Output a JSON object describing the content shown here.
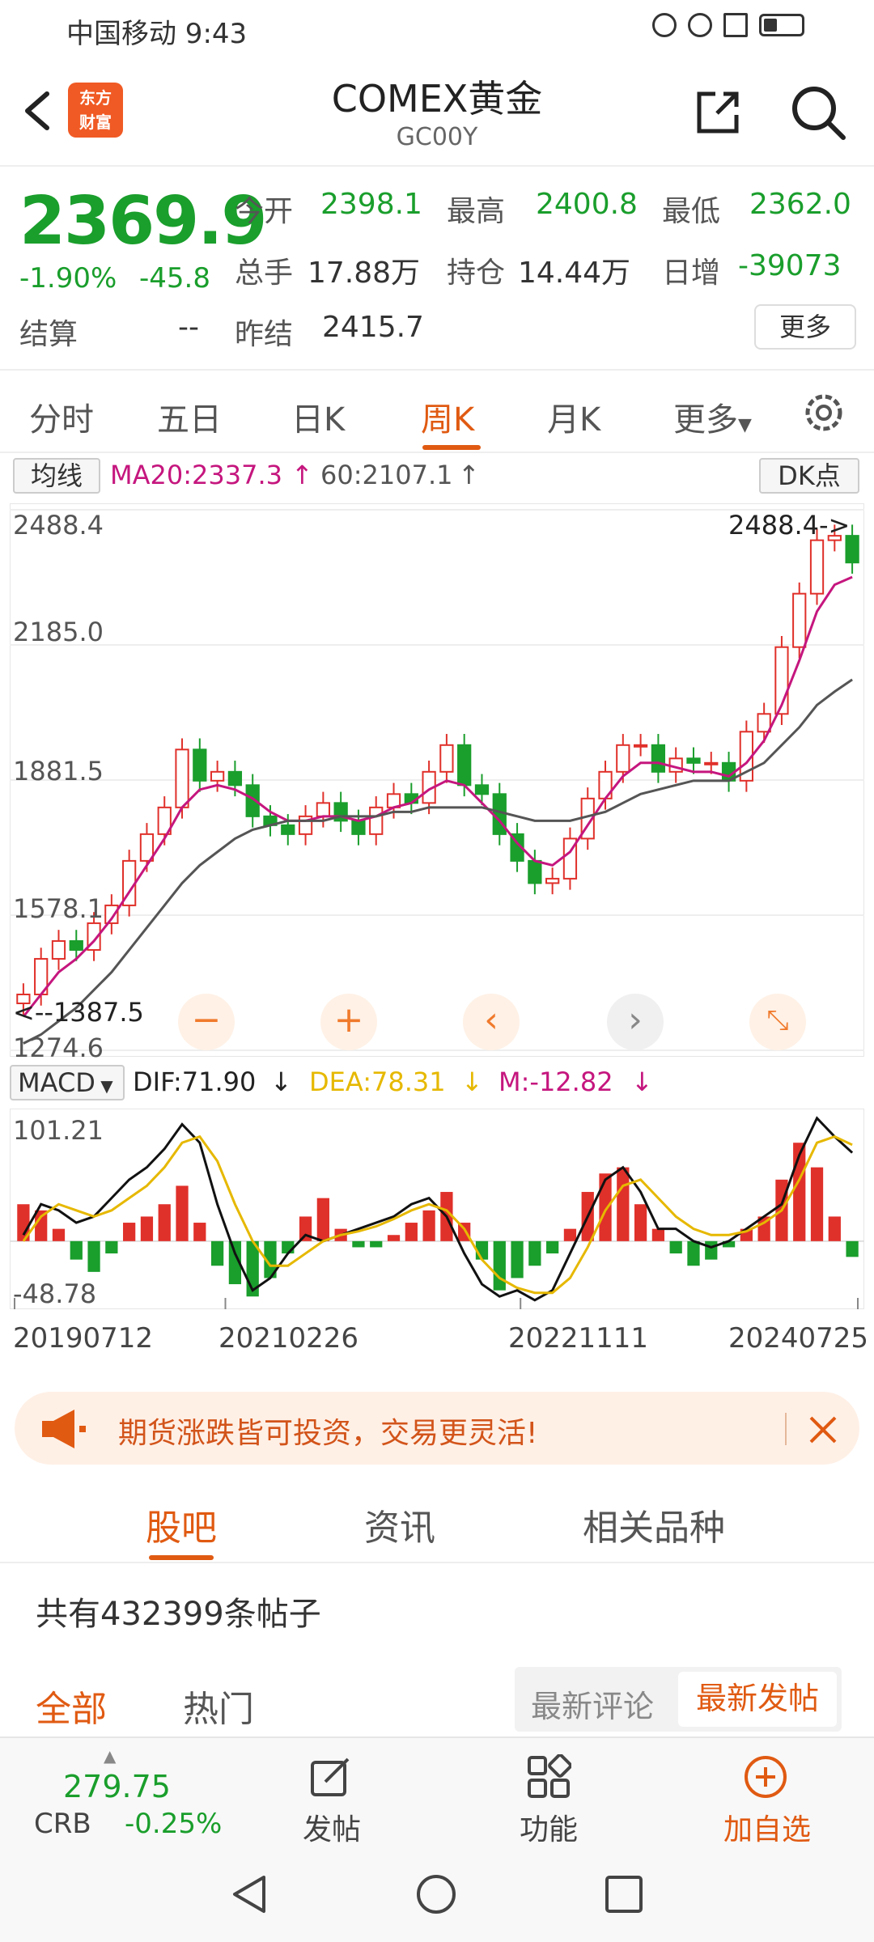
{
  "status_bar": {
    "time": "中国移动 9:43"
  },
  "header": {
    "logo_text_1": "东方",
    "logo_text_2": "财富",
    "title": "COMEX黄金",
    "subtitle": "GC00Y"
  },
  "quote": {
    "price": "2369.9",
    "change_pct": "-1.90%",
    "change": "-45.8",
    "open_label": "今开",
    "open_value": "2398.1",
    "high_label": "最高",
    "high_value": "2400.8",
    "low_label": "最低",
    "low_value": "2362.0",
    "volume_label": "总手",
    "volume_value": "17.88万",
    "position_label": "持仓",
    "position_value": "14.44万",
    "daily_inc_label": "日增",
    "daily_inc_value": "-39073",
    "settle_label": "结算",
    "settle_value": "--",
    "prev_settle_label": "昨结",
    "prev_settle_value": "2415.7",
    "more_label": "更多"
  },
  "tabs": [
    "分时",
    "五日",
    "日K",
    "周K",
    "月K",
    "更多"
  ],
  "active_tab": "周K",
  "indicators": {
    "ma_select": "均线",
    "ma20": "MA20:2337.3",
    "ma60": "60:2107.1",
    "dk_button": "DK点"
  },
  "chart_data": [
    {
      "type": "candlestick",
      "title": "",
      "y_ticks": [
        "2488.4",
        "2185.0",
        "1881.5",
        "1578.1",
        "1274.6"
      ],
      "ylim": [
        1274.6,
        2488.4
      ],
      "max_marker": "2488.4->",
      "min_marker": "<--1387.5",
      "x_ticks": [
        "20190712",
        "20210226",
        "20221111",
        "20240725"
      ],
      "series": [
        {
          "name": "K",
          "values": [
            1400,
            1480,
            1520,
            1500,
            1560,
            1600,
            1700,
            1760,
            1820,
            1950,
            1880,
            1900,
            1870,
            1800,
            1780,
            1760,
            1800,
            1830,
            1790,
            1760,
            1820,
            1850,
            1830,
            1900,
            1960,
            1870,
            1850,
            1760,
            1700,
            1650,
            1660,
            1750,
            1840,
            1900,
            1960,
            1960,
            1900,
            1930,
            1920,
            1920,
            1880,
            1990,
            2030,
            2180,
            2300,
            2420,
            2430,
            2369.9
          ]
        },
        {
          "name": "MA20",
          "values": [
            1350,
            1400,
            1450,
            1480,
            1520,
            1570,
            1630,
            1690,
            1750,
            1820,
            1860,
            1870,
            1860,
            1840,
            1810,
            1790,
            1790,
            1800,
            1800,
            1790,
            1800,
            1820,
            1830,
            1860,
            1880,
            1870,
            1830,
            1790,
            1740,
            1700,
            1690,
            1720,
            1780,
            1840,
            1890,
            1920,
            1920,
            1910,
            1900,
            1900,
            1890,
            1920,
            1970,
            2050,
            2150,
            2260,
            2320,
            2337.3
          ]
        },
        {
          "name": "MA60",
          "values": [
            1290,
            1310,
            1340,
            1370,
            1410,
            1450,
            1500,
            1550,
            1600,
            1650,
            1690,
            1720,
            1750,
            1770,
            1780,
            1790,
            1790,
            1790,
            1800,
            1800,
            1800,
            1810,
            1810,
            1820,
            1820,
            1820,
            1820,
            1810,
            1800,
            1790,
            1790,
            1790,
            1800,
            1810,
            1830,
            1850,
            1860,
            1870,
            1880,
            1880,
            1880,
            1900,
            1920,
            1960,
            2000,
            2050,
            2080,
            2107.1
          ]
        }
      ]
    },
    {
      "type": "bar",
      "title": "",
      "y_ticks": [
        "101.21",
        "-48.78"
      ],
      "ylim": [
        -48.78,
        101.21
      ],
      "indicator_select": "MACD",
      "dif_label": "DIF:71.90",
      "dea_label": "DEA:78.31",
      "m_label": "M:-12.82",
      "series": [
        {
          "name": "M",
          "values": [
            30,
            25,
            10,
            -15,
            -25,
            -10,
            15,
            20,
            30,
            45,
            15,
            -20,
            -35,
            -45,
            -30,
            -10,
            20,
            35,
            10,
            -5,
            -5,
            5,
            15,
            25,
            40,
            15,
            -15,
            -40,
            -30,
            -20,
            -10,
            10,
            40,
            55,
            60,
            30,
            10,
            -10,
            -20,
            -15,
            -5,
            10,
            20,
            50,
            80,
            60,
            20,
            -12.82
          ]
        },
        {
          "name": "DIF",
          "values": [
            5,
            30,
            25,
            15,
            20,
            35,
            50,
            60,
            75,
            95,
            80,
            30,
            -10,
            -40,
            -30,
            -10,
            5,
            0,
            5,
            10,
            15,
            20,
            30,
            35,
            20,
            -10,
            -35,
            -45,
            -40,
            -48,
            -40,
            -10,
            20,
            50,
            60,
            40,
            10,
            10,
            0,
            -5,
            0,
            10,
            20,
            30,
            70,
            100,
            85,
            71.9
          ]
        },
        {
          "name": "DEA",
          "values": [
            0,
            20,
            30,
            25,
            20,
            25,
            35,
            45,
            60,
            80,
            85,
            65,
            30,
            0,
            -20,
            -20,
            -10,
            0,
            5,
            8,
            12,
            18,
            25,
            30,
            25,
            10,
            -15,
            -30,
            -38,
            -42,
            -42,
            -30,
            -5,
            25,
            45,
            50,
            35,
            20,
            10,
            5,
            5,
            8,
            15,
            25,
            50,
            80,
            85,
            78.31
          ]
        }
      ]
    }
  ],
  "colors": {
    "accent": "#e05a12",
    "up": "#e0302a",
    "down": "#1a9e2c",
    "ma20": "#c5167e",
    "ma60": "#555555",
    "dea": "#e6b800"
  },
  "banner": {
    "text": "期货涨跌皆可投资，交易更灵活!"
  },
  "community_tabs": [
    "股吧",
    "资讯",
    "相关品种"
  ],
  "community": {
    "post_count": "共有432399条帖子",
    "filter_all": "全部",
    "filter_hot": "热门",
    "sort_latest_comment": "最新评论",
    "sort_latest_post": "最新发帖"
  },
  "bottom_bar": {
    "crb_value": "279.75",
    "crb_name": "CRB",
    "crb_change": "-0.25%",
    "post_label": "发帖",
    "function_label": "功能",
    "add_watch_label": "加自选"
  },
  "icons": [
    "back-icon",
    "share-icon",
    "search-icon",
    "settings-icon",
    "megaphone-icon",
    "close-icon",
    "edit-icon",
    "grid-icon",
    "add-circle-icon",
    "nav-back-icon",
    "nav-home-icon",
    "nav-recent-icon"
  ]
}
